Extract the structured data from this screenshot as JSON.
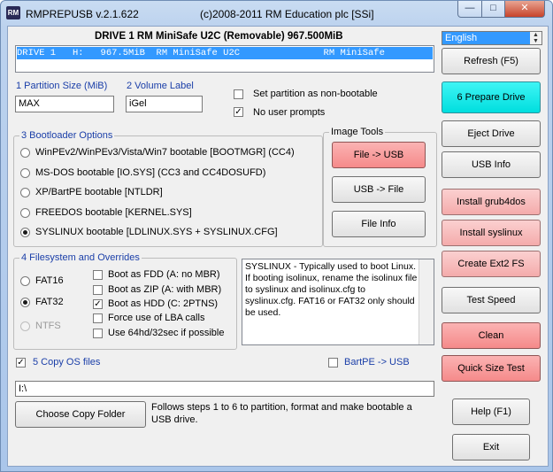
{
  "window": {
    "app_title": "RMPREPUSB v.2.1.622",
    "copyright": "(c)2008-2011 RM Education plc [SSi]",
    "icon_text": "RM",
    "minimize": "—",
    "maximize": "□",
    "close": "✕"
  },
  "drive": {
    "header": "DRIVE 1  RM MiniSafe U2C  (Removable) 967.500MiB",
    "row": "DRIVE 1   H:   967.5MiB  RM MiniSafe U2C               RM MiniSafe"
  },
  "partition": {
    "size_label": "1 Partition Size (MiB)",
    "size_value": "MAX",
    "volume_label": "2 Volume Label",
    "volume_value": "iGel",
    "non_bootable_label": "Set partition as non-bootable",
    "non_bootable_checked": false,
    "no_prompts_label": "No user prompts",
    "no_prompts_checked": true
  },
  "bootloader": {
    "title": "3 Bootloader Options",
    "options": [
      "WinPEv2/WinPEv3/Vista/Win7 bootable [BOOTMGR] (CC4)",
      "MS-DOS bootable [IO.SYS]   (CC3 and CC4DOSUFD)",
      "XP/BartPE bootable [NTLDR]",
      "FREEDOS bootable [KERNEL.SYS]",
      "SYSLINUX bootable [LDLINUX.SYS + SYSLINUX.CFG]"
    ],
    "selected": 4
  },
  "image_tools": {
    "title": "Image Tools",
    "file_to_usb": "File -> USB",
    "usb_to_file": "USB -> File",
    "file_info": "File Info"
  },
  "filesystem": {
    "title": "4 Filesystem and Overrides",
    "fs": [
      "FAT16",
      "FAT32",
      "NTFS"
    ],
    "selected_fs": "FAT32",
    "overrides": [
      {
        "label": "Boot as FDD (A: no MBR)",
        "checked": false
      },
      {
        "label": "Boot as ZIP (A: with MBR)",
        "checked": false
      },
      {
        "label": "Boot as HDD (C: 2PTNS)",
        "checked": true
      },
      {
        "label": "Force use of LBA calls",
        "checked": false
      },
      {
        "label": "Use 64hd/32sec if possible",
        "checked": false
      }
    ]
  },
  "info_text": "SYSLINUX - Typically used to boot Linux. If booting isolinux, rename the isolinux file to syslinux and isolinux.cfg to syslinux.cfg. FAT16 or FAT32 only should be used.",
  "copy": {
    "copy_os_label": "5 Copy OS files",
    "copy_os_checked": true,
    "bartpe_label": "BartPE -> USB",
    "bartpe_checked": false,
    "path_value": "I:\\",
    "choose_folder": "Choose Copy Folder",
    "hint": "Follows steps 1 to 6 to partition, format and make bootable a USB drive."
  },
  "sidebar": {
    "language": "English",
    "refresh": "Refresh (F5)",
    "prepare": "6 Prepare Drive",
    "eject": "Eject Drive",
    "usb_info": "USB Info",
    "grub4dos": "Install grub4dos",
    "syslinux": "Install syslinux",
    "ext2": "Create Ext2 FS",
    "test_speed": "Test Speed",
    "clean": "Clean",
    "quick_test": "Quick Size Test",
    "help": "Help (F1)",
    "exit": "Exit"
  },
  "colors": {
    "prepare": "#00e0e0",
    "red_button": "#f58a8a",
    "pink_button": "#f4abab",
    "selection": "#3399ff",
    "label_blue": "#1a3ea8"
  }
}
